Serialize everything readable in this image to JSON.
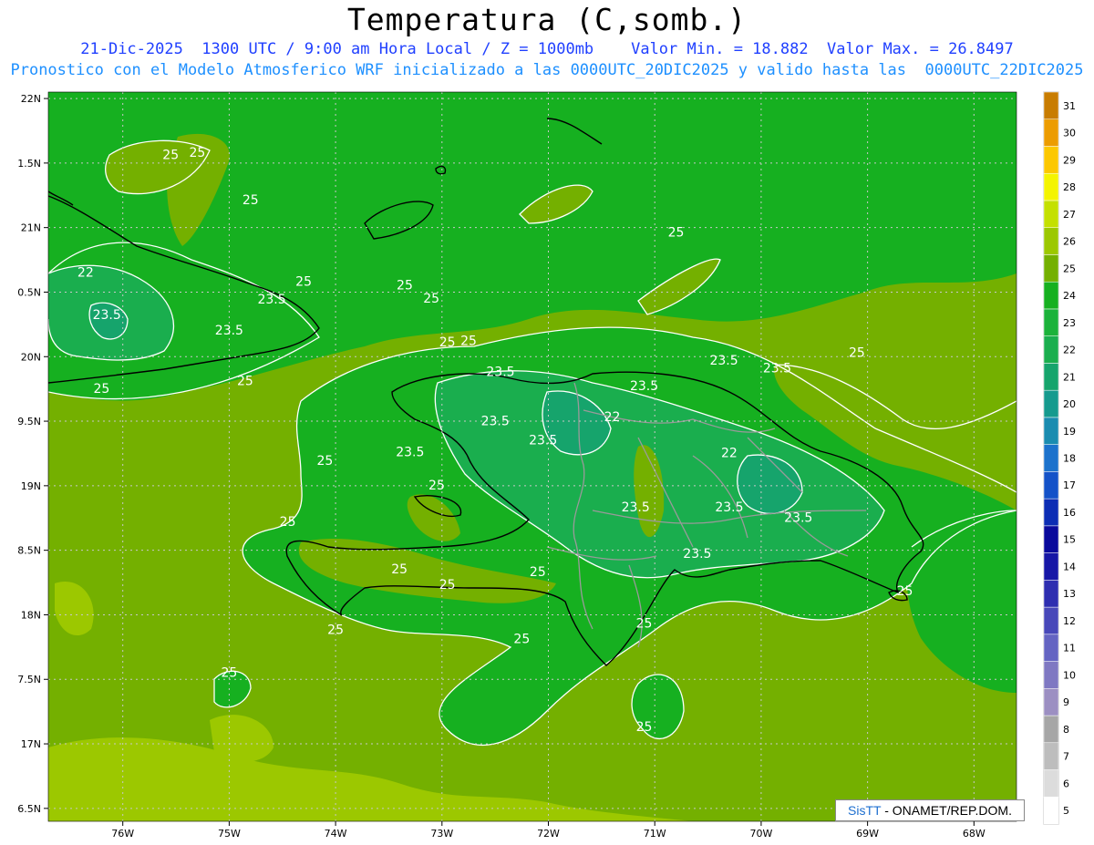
{
  "title": "Temperatura (C,somb.)",
  "subtitle_line1": "21-Dic-2025  1300 UTC / 9:00 am Hora Local / Z = 1000mb    Valor Min. = 18.882  Valor Max. = 26.8497",
  "subtitle_line2": "Pronostico con el Modelo Atmosferico WRF inicializado a las 0000UTC_20DIC2025 y valido hasta las  0000UTC_22DIC2025",
  "credit": {
    "brand": "SisTT",
    "text": "- ONAMET/REP.DOM."
  },
  "chart_data": {
    "type": "heatmap",
    "xaxis_ticks": [
      "76W",
      "75W",
      "74W",
      "73W",
      "72W",
      "71W",
      "70W",
      "69W",
      "68W"
    ],
    "yaxis_ticks": [
      "22N",
      "1.5N",
      "21N",
      "0.5N",
      "20N",
      "9.5N",
      "19N",
      "8.5N",
      "18N",
      "7.5N",
      "17N",
      "6.5N"
    ],
    "xlim": [
      -76.7,
      -67.6
    ],
    "ylim": [
      16.4,
      22.05
    ],
    "colorbar": {
      "levels": [
        5,
        6,
        7,
        8,
        9,
        10,
        11,
        12,
        13,
        14,
        15,
        16,
        17,
        18,
        19,
        20,
        21,
        22,
        23,
        24,
        25,
        26,
        27,
        28,
        29,
        30,
        31
      ],
      "colors": [
        "#ffffff",
        "#dcdcdc",
        "#bdbdbd",
        "#a6a6a6",
        "#9c8fc2",
        "#7f78c2",
        "#6464c2",
        "#4848b9",
        "#2e2eb0",
        "#1717a6",
        "#0a0a9c",
        "#0c2db4",
        "#1452c8",
        "#1c72cc",
        "#1a8cb0",
        "#159a8e",
        "#16a46c",
        "#1aae4e",
        "#1bb23a",
        "#16b020",
        "#74b000",
        "#9cc800",
        "#c4e000",
        "#f4f400",
        "#fcc800",
        "#ec9c00",
        "#c87c00"
      ]
    },
    "contour_labels": [
      "25",
      "25",
      "25",
      "25",
      "25",
      "25",
      "25",
      "25",
      "25",
      "25",
      "25",
      "25",
      "25",
      "25",
      "25",
      "25",
      "25",
      "25",
      "25",
      "25",
      "25",
      "25",
      "25",
      "25",
      "22",
      "22",
      "22",
      "23.5",
      "23.5",
      "23.5",
      "23.5",
      "23.5",
      "23.5",
      "23.5",
      "23.5",
      "23.5",
      "23.5",
      "23.5",
      "23.5",
      "23.5",
      "23.5"
    ]
  }
}
